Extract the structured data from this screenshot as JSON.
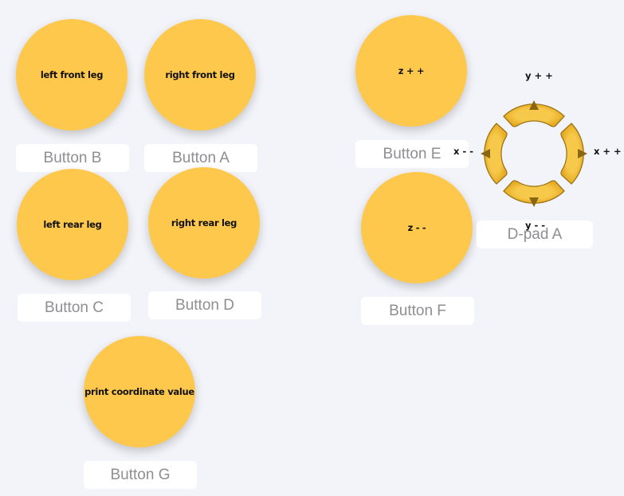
{
  "buttons": {
    "b": {
      "text": "left front leg",
      "caption": "Button B"
    },
    "a": {
      "text": "right front leg",
      "caption": "Button A"
    },
    "c": {
      "text": "left rear leg",
      "caption": "Button C"
    },
    "d": {
      "text": "right rear leg",
      "caption": "Button D"
    },
    "g": {
      "text": "print coordinate value",
      "caption": "Button G"
    },
    "e": {
      "text": "z + +",
      "caption": "Button E"
    },
    "f": {
      "text": "z - -",
      "caption": "Button F"
    }
  },
  "dpad": {
    "caption": "D-pad A",
    "up_label": "y + +",
    "down_label": "y - -",
    "left_label": "x - -",
    "right_label": "x + +"
  },
  "colors": {
    "button_fill": "#fec84c",
    "caption_text": "#8e8e93",
    "background": "#f3f4f9",
    "dpad_fill": "#f3be37",
    "dpad_arrow": "#8a6512"
  },
  "icons": [
    "arrow-up-icon",
    "arrow-down-icon",
    "arrow-left-icon",
    "arrow-right-icon"
  ]
}
